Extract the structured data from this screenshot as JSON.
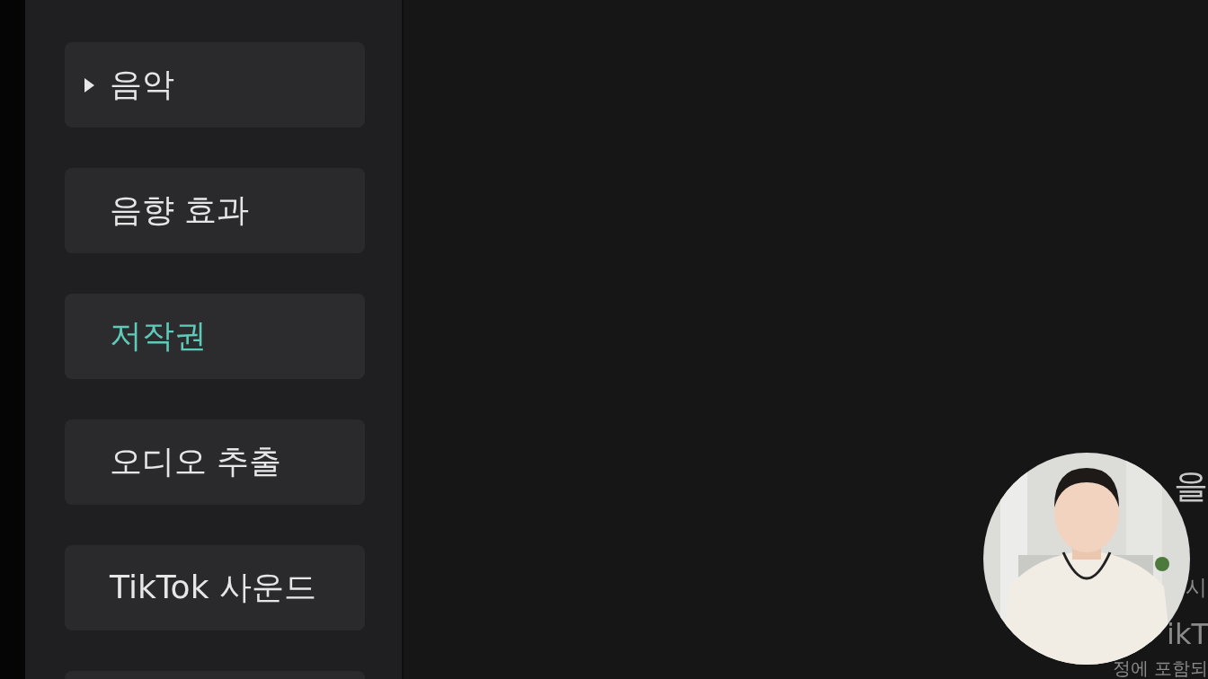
{
  "sidebar": {
    "items": [
      {
        "label": "음악",
        "selected": false,
        "expanded": false
      },
      {
        "label": "음향 효과",
        "selected": false
      },
      {
        "label": "저작권",
        "selected": true
      },
      {
        "label": "오디오 추출",
        "selected": false
      },
      {
        "label": "TikTok 사운드",
        "selected": false
      }
    ],
    "more_below": true
  },
  "main": {
    "partial_texts": [
      "을",
      "시",
      "ikT",
      "정에 포함되"
    ]
  }
}
